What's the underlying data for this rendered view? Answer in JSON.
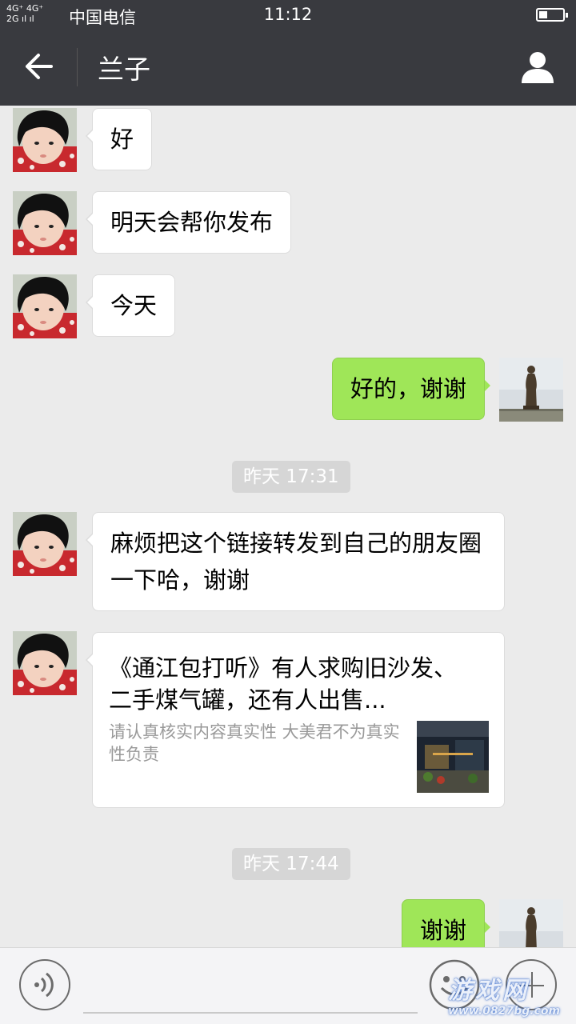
{
  "status_bar": {
    "network": [
      "4G⁺ 4G⁺",
      "2G ıl ıl"
    ],
    "carrier": "中国电信",
    "time": "11:12",
    "battery_level_fraction": 0.3
  },
  "header": {
    "back_icon": "arrow-left-icon",
    "title": "兰子",
    "profile_icon": "person-icon"
  },
  "messages": [
    {
      "side": "in",
      "text": "好"
    },
    {
      "side": "in",
      "text": "明天会帮你发布"
    },
    {
      "side": "in",
      "text": "今天"
    },
    {
      "side": "out",
      "text": "好的，谢谢"
    },
    {
      "type": "timestamp",
      "text": "昨天 17:31"
    },
    {
      "side": "in",
      "text": "麻烦把这个链接转发到自己的朋友圈一下哈，谢谢"
    },
    {
      "side": "in",
      "type": "link-card",
      "title": "《通江包打听》有人求购旧沙发、二手煤气罐，还有人出售...",
      "description": "请认真核实内容真实性 大美君不为真实性负责"
    },
    {
      "type": "timestamp",
      "text": "昨天 17:44"
    },
    {
      "side": "out",
      "text": "谢谢"
    }
  ],
  "input_bar": {
    "voice_icon": "voice-icon",
    "emoji_icon": "emoji-icon",
    "plus_icon": "plus-icon"
  },
  "watermark": {
    "text": "游戏网",
    "url": "www.0827bg.com"
  },
  "colors": {
    "header_bg": "#393a3f",
    "chat_bg": "#ebebeb",
    "outgoing_bubble": "#9fe658",
    "incoming_bubble": "#ffffff",
    "timestamp_bg": "#d6d6d6"
  }
}
